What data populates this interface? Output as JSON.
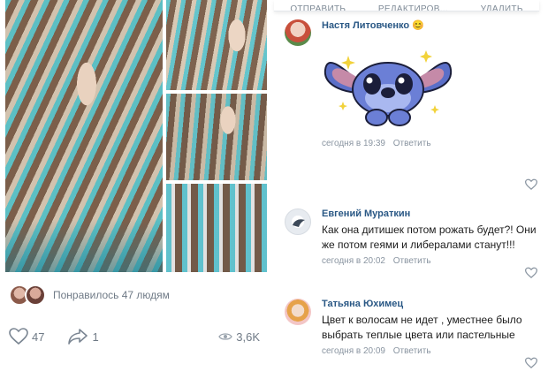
{
  "context_menu": {
    "items": [
      "ОТПРАВИТЬ",
      "РЕДАКТИРОВ...",
      "УДАЛИТЬ"
    ]
  },
  "post": {
    "likes_text": "Понравилось 47 людям",
    "like_count": "47",
    "share_count": "1",
    "views": "3,6K"
  },
  "comments": [
    {
      "author": "Настя Литовченко 😊",
      "text": "",
      "time": "сегодня в 19:39",
      "reply": "Ответить",
      "sticker": "stitch-sticker"
    },
    {
      "author": "Евгений Мураткин",
      "text": "Как она дитишек потом рожать будет?! Они же потом геями и либералами станут!!!",
      "time": "сегодня в 20:02",
      "reply": "Ответить"
    },
    {
      "author": "Татьяна Юхимец",
      "text": "Цвет к волосам не идет , уместнее было выбрать теплые цвета или пастельные",
      "time": "сегодня в 20:09",
      "reply": "Ответить"
    }
  ],
  "colors": {
    "link": "#2a5885",
    "meta": "#8a95a1",
    "accent_teal": "#4fc3d0"
  }
}
